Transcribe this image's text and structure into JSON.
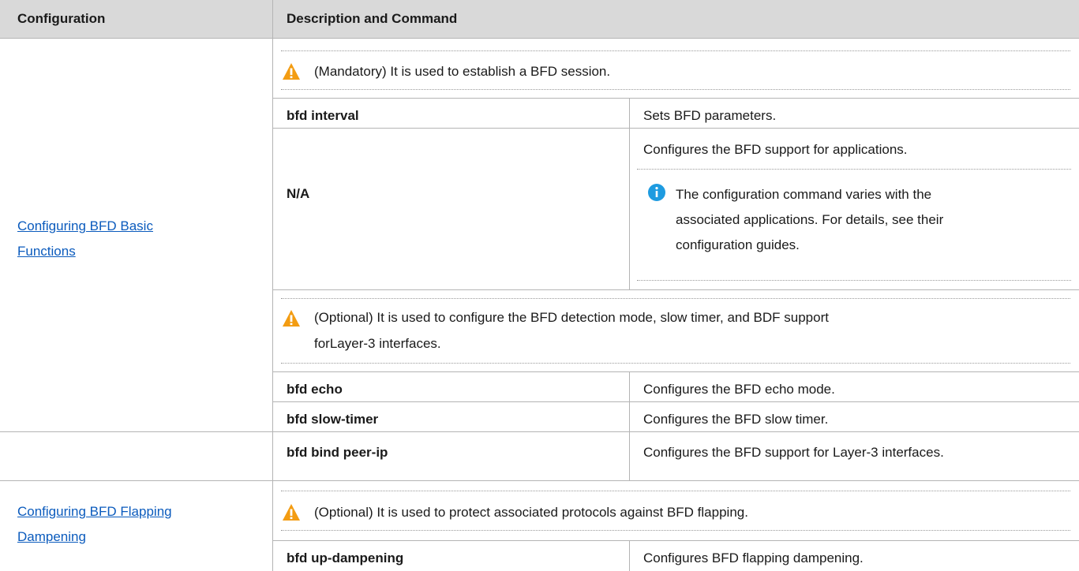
{
  "header": {
    "col1": "Configuration",
    "col2": "Description and Command"
  },
  "section1": {
    "link_line1": "Configuring BFD Basic ",
    "link_line2": "Functions",
    "note_mandatory": "(Mandatory) It is used to establish a BFD session.",
    "rows": [
      {
        "command": "bfd interval",
        "description": "Sets BFD parameters."
      }
    ],
    "na_command": "N/A",
    "na_description": "Configures the BFD support for applications.",
    "info_line1": "The configuration command varies with the",
    "info_line2": "associated applications. For details, see their",
    "info_line3": "configuration guides.",
    "note_optional_line1": "(Optional) It is used to configure the BFD detection mode, slow timer, and BDF support",
    "note_optional_line2": "forLayer-3 interfaces.",
    "rows2": [
      {
        "command": "bfd echo",
        "description": "Configures the BFD echo mode."
      },
      {
        "command": "bfd slow-timer",
        "description": "Configures the BFD slow timer."
      },
      {
        "command": "bfd bind peer-ip",
        "description": "Configures the BFD support for Layer-3 interfaces."
      }
    ]
  },
  "section2": {
    "link_line1": "Configuring BFD Flapping ",
    "link_line2": "Dampening",
    "note_optional": "(Optional) It is used to protect associated protocols against BFD flapping.",
    "rows": [
      {
        "command": "bfd up-dampening",
        "description": "Configures BFD flapping dampening."
      }
    ]
  },
  "icons": {
    "warning": "warning-icon",
    "info": "info-icon"
  },
  "colors": {
    "header_bg": "#d9d9d9",
    "link": "#0b5bbd",
    "warning": "#f39c12",
    "info": "#1e9be0"
  }
}
